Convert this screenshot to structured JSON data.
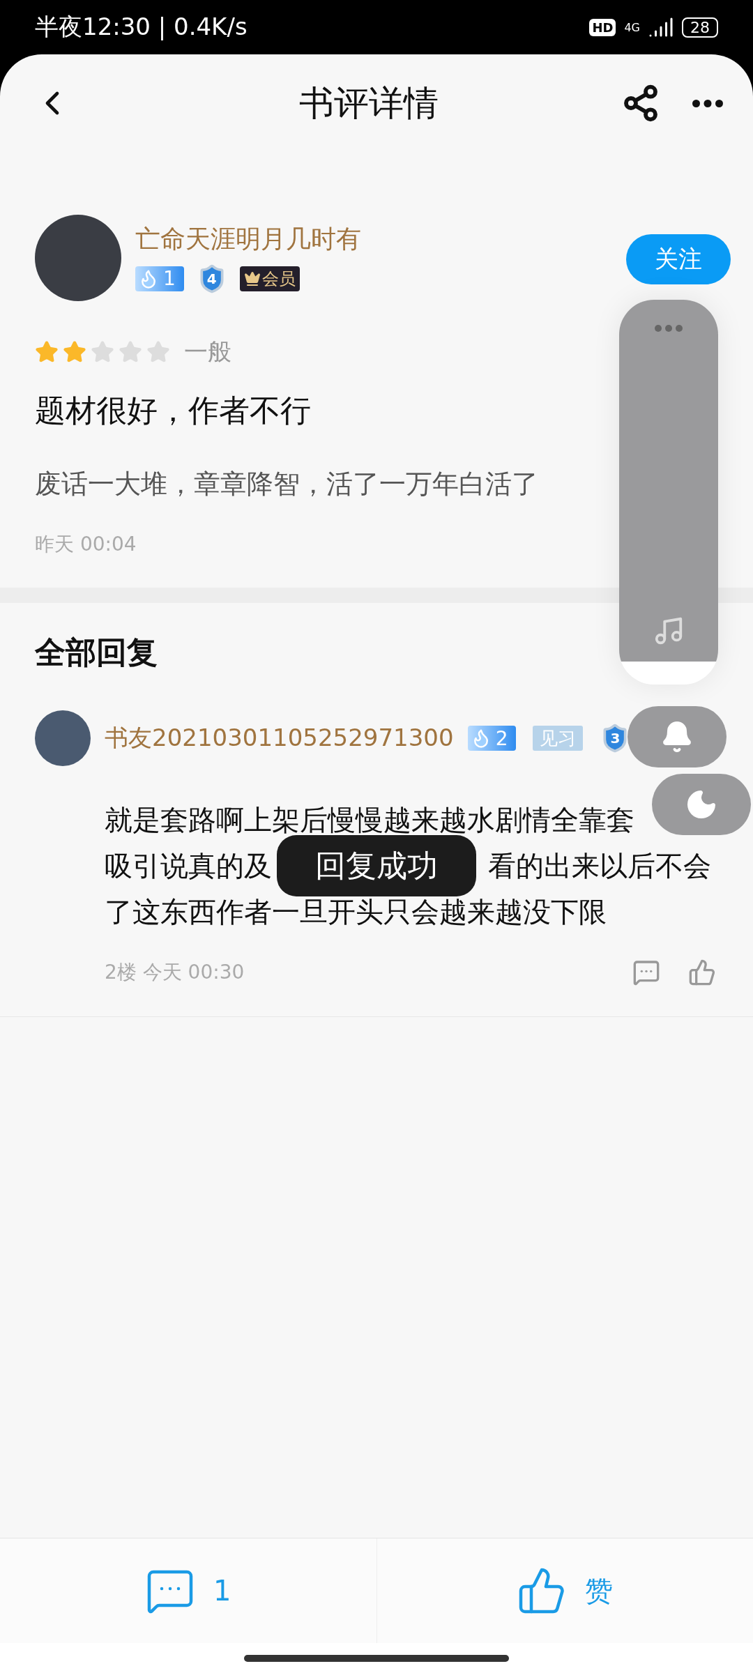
{
  "status_bar": {
    "time": "半夜12:30 | 0.4K/s",
    "hd": "HD",
    "network": "4G",
    "battery": "28"
  },
  "header": {
    "title": "书评详情"
  },
  "review": {
    "author": "亡命天涯明月几时有",
    "badges": [
      {
        "kind": "fire",
        "text": "1"
      },
      {
        "kind": "shield",
        "text": "4"
      },
      {
        "kind": "vip",
        "text": "会员"
      }
    ],
    "follow": "关注",
    "stars": 2,
    "rating_label": "一般",
    "title": "题材很好，作者不行",
    "body": "废话一大堆，章章降智，活了一万年白活了",
    "time": "昨天 00:04"
  },
  "replies_section": {
    "title": "全部回复",
    "replies": [
      {
        "author": "书友20210301105252971300",
        "badges": [
          {
            "kind": "fire",
            "text": "2"
          },
          {
            "kind": "tag",
            "text": "见习"
          },
          {
            "kind": "shield",
            "text": "3"
          }
        ],
        "lines": [
          [
            "就是套路啊上架后慢慢越来越水剧情全靠套"
          ],
          [
            "吸引说真的及",
            "看的出来以后不会"
          ],
          [
            "了这东西作者一旦开头只会越来越没下限"
          ]
        ],
        "meta": "2楼 今天 00:30"
      }
    ]
  },
  "toast": "回复成功",
  "bottom_bar": {
    "comments": "1",
    "like": "赞"
  }
}
